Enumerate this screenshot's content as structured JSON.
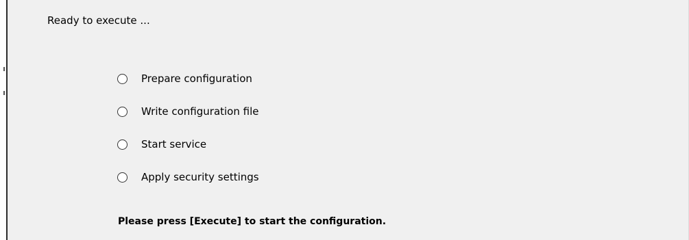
{
  "status": {
    "heading": "Ready to execute ..."
  },
  "steps": [
    {
      "label": "Prepare configuration",
      "selected": false
    },
    {
      "label": "Write configuration file",
      "selected": false
    },
    {
      "label": "Start service",
      "selected": false
    },
    {
      "label": "Apply security settings",
      "selected": false
    }
  ],
  "footer": {
    "instruction": "Please press [Execute] to start the configuration."
  },
  "colors": {
    "panel_background": "#f0f0f0",
    "text": "#000000",
    "radio_border": "#333333"
  },
  "icons": {
    "step_indicator": "radio-circle-icon"
  }
}
